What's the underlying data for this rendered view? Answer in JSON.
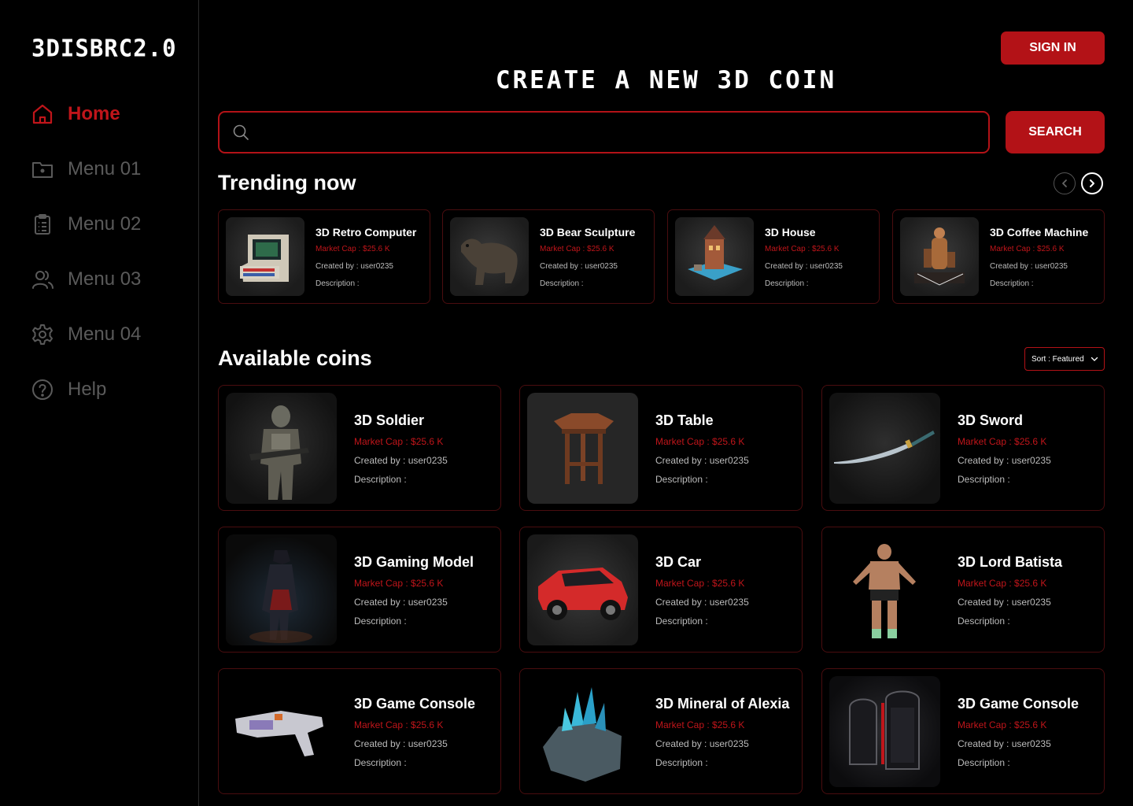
{
  "app": {
    "logo": "3DISBRC2.0"
  },
  "sidebar": {
    "items": [
      {
        "label": "Home",
        "icon": "home-icon",
        "active": true
      },
      {
        "label": "Menu 01",
        "icon": "folder-icon"
      },
      {
        "label": "Menu 02",
        "icon": "clipboard-icon"
      },
      {
        "label": "Menu 03",
        "icon": "users-icon"
      },
      {
        "label": "Menu 04",
        "icon": "gear-icon"
      },
      {
        "label": "Help",
        "icon": "help-icon"
      }
    ]
  },
  "header": {
    "sign_in_label": "SIGN IN",
    "title": "CREATE A NEW 3D COIN",
    "search_placeholder": "",
    "search_button": "SEARCH"
  },
  "trending": {
    "title": "Trending now",
    "items": [
      {
        "name": "3D Retro Computer",
        "market_cap": "Market Cap : $25.6 K",
        "created_by": "Created by : user0235",
        "description": "Description :"
      },
      {
        "name": "3D Bear Sculpture",
        "market_cap": "Market Cap : $25.6 K",
        "created_by": "Created by : user0235",
        "description": "Description :"
      },
      {
        "name": "3D House",
        "market_cap": "Market Cap : $25.6 K",
        "created_by": "Created by : user0235",
        "description": "Description :"
      },
      {
        "name": "3D Coffee Machine",
        "market_cap": "Market Cap : $25.6 K",
        "created_by": "Created by : user0235",
        "description": "Description :"
      }
    ]
  },
  "available": {
    "title": "Available coins",
    "sort_label": "Sort : Featured",
    "items": [
      {
        "name": "3D Soldier",
        "market_cap": "Market Cap : $25.6 K",
        "created_by": "Created by : user0235",
        "description": "Description :"
      },
      {
        "name": "3D Table",
        "market_cap": "Market Cap : $25.6 K",
        "created_by": "Created by : user0235",
        "description": "Description :"
      },
      {
        "name": "3D Sword",
        "market_cap": "Market Cap : $25.6 K",
        "created_by": "Created by : user0235",
        "description": "Description :"
      },
      {
        "name": "3D Gaming Model",
        "market_cap": "Market Cap : $25.6 K",
        "created_by": "Created by : user0235",
        "description": "Description :"
      },
      {
        "name": "3D Car",
        "market_cap": "Market Cap : $25.6 K",
        "created_by": "Created by : user0235",
        "description": "Description :"
      },
      {
        "name": "3D Lord Batista",
        "market_cap": "Market Cap : $25.6 K",
        "created_by": "Created by : user0235",
        "description": "Description :"
      },
      {
        "name": "3D Game Console",
        "market_cap": "Market Cap : $25.6 K",
        "created_by": "Created by : user0235",
        "description": "Description :"
      },
      {
        "name": "3D Mineral of Alexia",
        "market_cap": "Market Cap : $25.6 K",
        "created_by": "Created by : user0235",
        "description": "Description :"
      },
      {
        "name": "3D Game Console",
        "market_cap": "Market Cap : $25.6 K",
        "created_by": "Created by : user0235",
        "description": "Description :"
      }
    ]
  },
  "colors": {
    "accent": "#b31217",
    "accent_text": "#c0151a",
    "background": "#000000",
    "muted": "#5a5a5a"
  }
}
